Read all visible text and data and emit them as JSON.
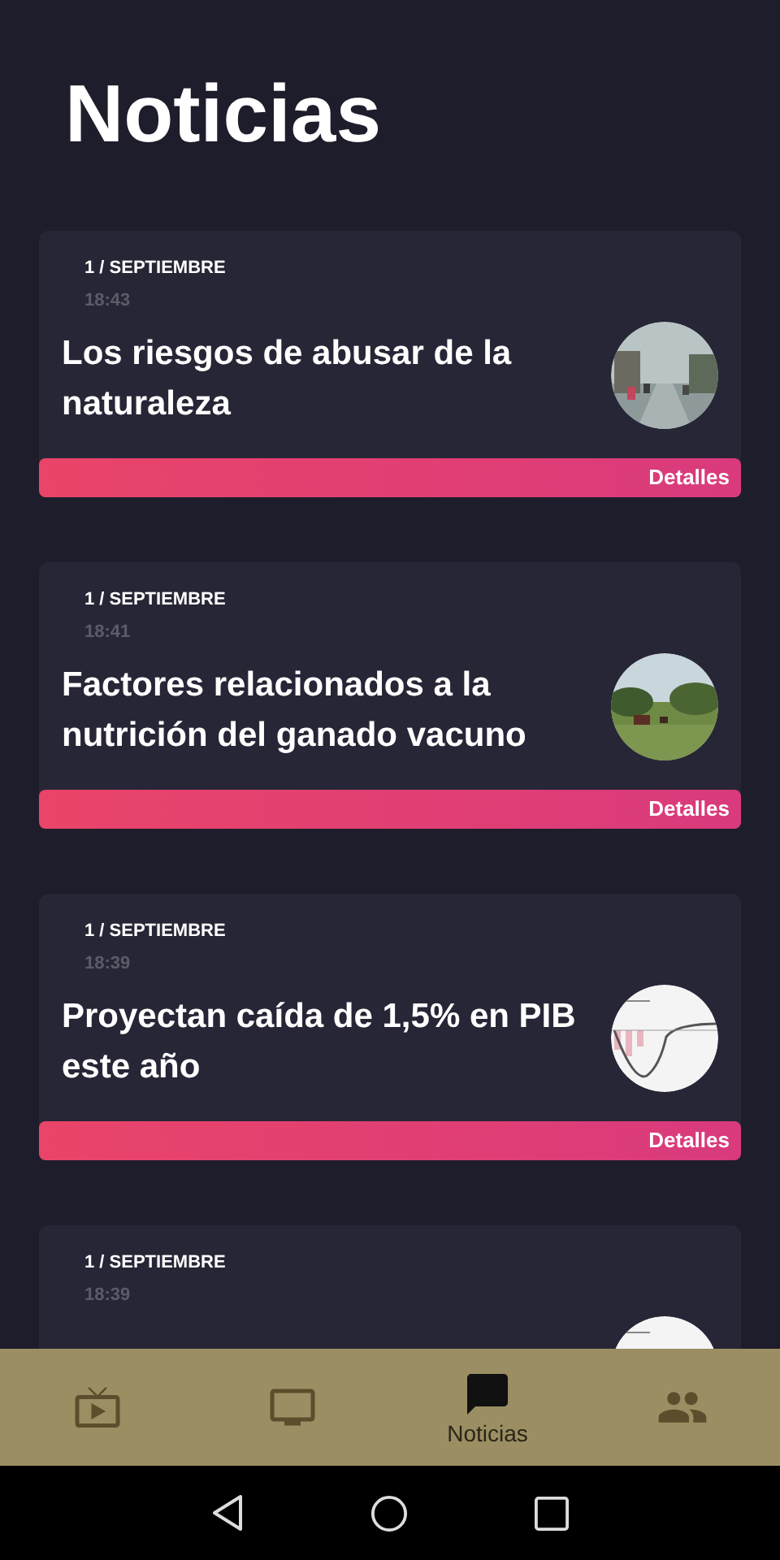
{
  "header": {
    "title": "Noticias"
  },
  "news": [
    {
      "date": "1 / SEPTIEMBRE",
      "time": "18:43",
      "title": "Los riesgos de abusar de la naturaleza",
      "action": "Detalles"
    },
    {
      "date": "1 / SEPTIEMBRE",
      "time": "18:41",
      "title": "Factores relacionados a la nutrición del ganado vacuno",
      "action": "Detalles"
    },
    {
      "date": "1 / SEPTIEMBRE",
      "time": "18:39",
      "title": "Proyectan caída de 1,5% en PIB este año",
      "action": "Detalles"
    },
    {
      "date": "1 / SEPTIEMBRE",
      "time": "18:39"
    }
  ],
  "bottom_nav": [
    {
      "selected": false
    },
    {
      "selected": false
    },
    {
      "label": "Noticias",
      "selected": true
    },
    {
      "selected": false
    }
  ]
}
